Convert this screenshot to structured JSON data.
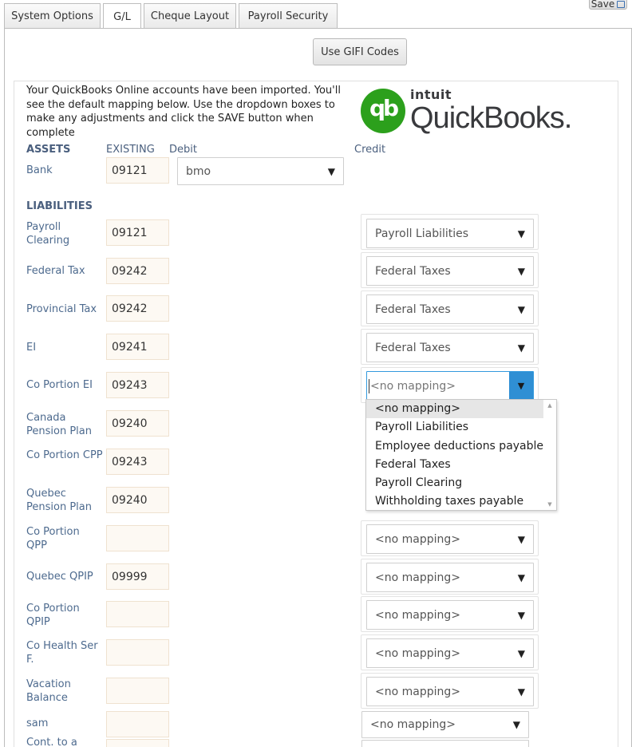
{
  "toolbar": {
    "save_label": "Save"
  },
  "tabs": [
    {
      "label": "System Options"
    },
    {
      "label": "G/L"
    },
    {
      "label": "Cheque Layout"
    },
    {
      "label": "Payroll Security"
    }
  ],
  "gifi_button": "Use GIFI Codes",
  "intro_text": "Your QuickBooks Online accounts have been imported. You'll see the default mapping below. Use the dropdown boxes to make any adjustments and click the SAVE button when complete",
  "logo": {
    "intuit": "intuit",
    "wordmark": "QuickBooks."
  },
  "headers": {
    "assets": "ASSETS",
    "existing": "EXISTING",
    "debit": "Debit",
    "credit": "Credit",
    "liabilities": "LIABILITIES"
  },
  "bank": {
    "label": "Bank",
    "account": "09121",
    "debit_value": "bmo"
  },
  "rows": [
    {
      "label": "Payroll Clearing",
      "account": "09121",
      "credit": "Payroll Liabilities"
    },
    {
      "label": "Federal Tax",
      "account": "09242",
      "credit": "Federal Taxes"
    },
    {
      "label": "Provincial Tax",
      "account": "09242",
      "credit": "Federal Taxes"
    },
    {
      "label": "EI",
      "account": "09241",
      "credit": "Federal Taxes"
    },
    {
      "label": "Co Portion EI",
      "account": "09243",
      "credit": "<no mapping>"
    },
    {
      "label": "Canada Pension Plan",
      "account": "09240",
      "credit": ""
    },
    {
      "label": "Co Portion CPP",
      "account": "09243",
      "credit": ""
    },
    {
      "label": "Quebec Pension Plan",
      "account": "09240",
      "credit": ""
    },
    {
      "label": "Co Portion QPP",
      "account": "",
      "credit": "<no mapping>"
    },
    {
      "label": "Quebec QPIP",
      "account": "09999",
      "credit": "<no mapping>"
    },
    {
      "label": "Co Portion QPIP",
      "account": "",
      "credit": "<no mapping>"
    },
    {
      "label": "Co Health Ser F.",
      "account": "",
      "credit": "<no mapping>"
    },
    {
      "label": "Vacation Balance",
      "account": "",
      "credit": "<no mapping>"
    },
    {
      "label": "sam",
      "account": "",
      "credit": "<no mapping>"
    },
    {
      "label": "Cont. to a",
      "account": "",
      "credit": ""
    }
  ],
  "dropdown_options": [
    "<no mapping>",
    "Payroll Liabilities",
    "Employee deductions payable",
    "Federal Taxes",
    "Payroll Clearing",
    "Withholding taxes payable"
  ],
  "colors": {
    "qb_green": "#2ca01c",
    "label_blue": "#4d6a8e",
    "focus_blue": "#2f8fd4"
  },
  "icons": {
    "save": "disk-icon",
    "dropdown": "triangle-down-icon"
  }
}
